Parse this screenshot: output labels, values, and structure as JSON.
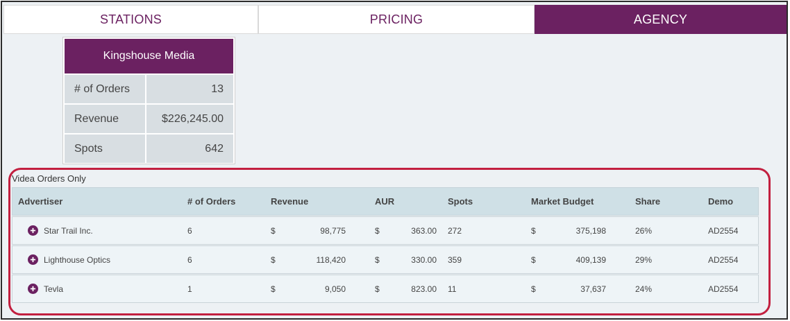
{
  "tabs": [
    {
      "label": "STATIONS",
      "active": false
    },
    {
      "label": "PRICING",
      "active": false
    },
    {
      "label": "AGENCY",
      "active": true
    }
  ],
  "summary": {
    "title": "Kingshouse Media",
    "rows": [
      {
        "label": "# of Orders",
        "value": "13"
      },
      {
        "label": "Revenue",
        "value": "$226,245.00"
      },
      {
        "label": "Spots",
        "value": "642"
      }
    ]
  },
  "section": {
    "title": "Videa Orders Only"
  },
  "table": {
    "headers": [
      "Advertiser",
      "# of Orders",
      "Revenue",
      "AUR",
      "Spots",
      "Market Budget",
      "Share",
      "Demo"
    ],
    "currency_symbol": "$",
    "rows": [
      {
        "advertiser": "Star Trail Inc.",
        "orders": "6",
        "revenue": "98,775",
        "aur": "363.00",
        "spots": "272",
        "market_budget": "375,198",
        "share": "26%",
        "demo": "AD2554"
      },
      {
        "advertiser": "Lighthouse Optics",
        "orders": "6",
        "revenue": "118,420",
        "aur": "330.00",
        "spots": "359",
        "market_budget": "409,139",
        "share": "29%",
        "demo": "AD2554"
      },
      {
        "advertiser": "Tevla",
        "orders": "1",
        "revenue": "9,050",
        "aur": "823.00",
        "spots": "11",
        "market_budget": "37,637",
        "share": "24%",
        "demo": "AD2554"
      }
    ]
  },
  "colors": {
    "brand": "#6b2161",
    "highlight": "#c21f3f",
    "header_bg": "#cfe0e6",
    "row_bg": "#eef4f7"
  },
  "icons": {
    "expand": "plus-circle-icon"
  }
}
